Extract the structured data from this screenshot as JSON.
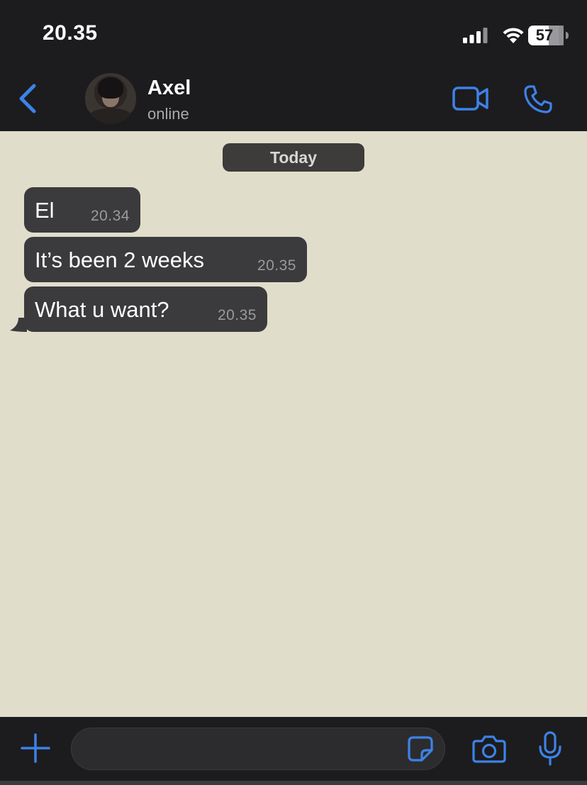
{
  "status_bar": {
    "time": "20.35",
    "battery_level": "57",
    "icons": [
      "signal-icon",
      "wifi-icon",
      "battery-icon"
    ]
  },
  "header": {
    "contact_name": "Axel",
    "contact_status": "online",
    "icons": [
      "back-icon",
      "avatar",
      "video-call-icon",
      "phone-call-icon"
    ]
  },
  "chat": {
    "date_separator": "Today",
    "messages": [
      {
        "text": "El",
        "time": "20.34"
      },
      {
        "text": "It’s been 2 weeks",
        "time": "20.35"
      },
      {
        "text": "What u want?",
        "time": "20.35"
      }
    ]
  },
  "composer": {
    "input_value": "",
    "icons": [
      "plus-icon",
      "sticker-icon",
      "camera-icon",
      "microphone-icon"
    ]
  },
  "colors": {
    "accent": "#3d82e8",
    "chat_background": "#e0decb",
    "bubble": "#3b3b3d",
    "bar_background": "#1c1c1e"
  }
}
